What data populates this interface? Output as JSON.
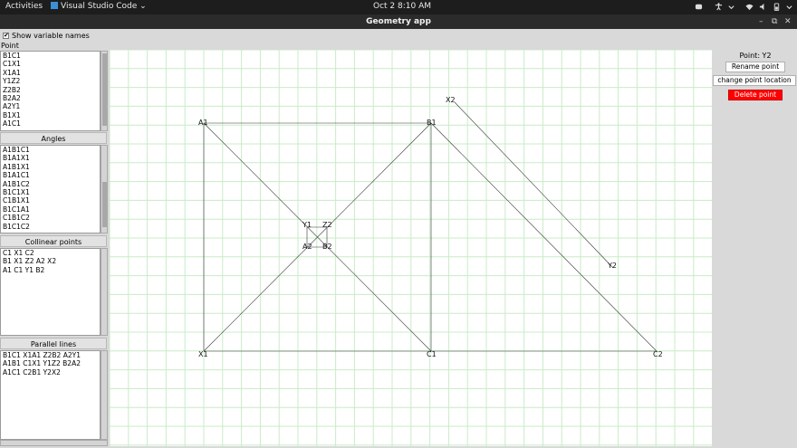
{
  "topbar": {
    "activities": "Activities",
    "app_name": "Visual Studio Code",
    "clock": "Oct 2   8:10 AM"
  },
  "window": {
    "title": "Geometry app"
  },
  "left_panel": {
    "show_variable_names": "Show variable names",
    "show_variable_names_checked": true,
    "point_label": "Point",
    "points": [
      "B1C1",
      "C1X1",
      "X1A1",
      "Y1Z2",
      "Z2B2",
      "B2A2",
      "A2Y1",
      "B1X1",
      "A1C1"
    ],
    "angles_label": "Angles",
    "angles": [
      "A1B1C1",
      "B1A1X1",
      "A1B1X1",
      "B1A1C1",
      "A1B1C2",
      "B1C1X1",
      "C1B1X1",
      "B1C1A1",
      "C1B1C2",
      "B1C1C2"
    ],
    "collinear_label": "Collinear points",
    "collinear": [
      "C1 X1 C2",
      "B1 X1 Z2 A2 X2",
      "A1 C1 Y1 B2"
    ],
    "parallel_label": "Parallel lines",
    "parallel": [
      "B1C1 X1A1 Z2B2 A2Y1",
      "A1B1 C1X1 Y1Z2 B2A2",
      "A1C1 C2B1 Y2X2"
    ]
  },
  "canvas": {
    "grid_color": "#c8ecc8",
    "points": [
      {
        "name": "A1"
      },
      {
        "name": "B1"
      },
      {
        "name": "X1"
      },
      {
        "name": "C1"
      },
      {
        "name": "C2"
      },
      {
        "name": "X2"
      },
      {
        "name": "Y2"
      },
      {
        "name": "Y1"
      },
      {
        "name": "Z2"
      },
      {
        "name": "A2"
      },
      {
        "name": "B2"
      }
    ]
  },
  "right_panel": {
    "selected_point": "Point: Y2",
    "rename_label": "Rename point",
    "change_label": "change point location",
    "delete_label": "Delete point",
    "delete_color": "#ff0000"
  }
}
